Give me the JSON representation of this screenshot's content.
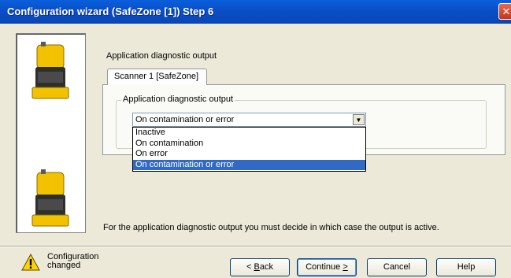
{
  "window": {
    "title": "Configuration wizard (SafeZone [1]) Step 6",
    "close_glyph": "✕"
  },
  "content": {
    "section_title": "Application diagnostic output",
    "tab_label": "Scanner 1 [SafeZone]",
    "group_label": "Application diagnostic output",
    "select_value": "On contamination or error",
    "dropdown_options": [
      "Inactive",
      "On contamination",
      "On error",
      "On contamination or error"
    ],
    "selected_option": "On contamination or error",
    "hint": "For the application diagnostic output you must decide in which case the output is active."
  },
  "status": {
    "line1": "Configuration",
    "line2": "changed"
  },
  "buttons": {
    "back_access": "B",
    "back_rest": "ack",
    "continue_rest": "Continue ",
    "continue_access": ">",
    "cancel": "Cancel",
    "help": "Help"
  },
  "colors": {
    "title_bar": "#0a4fc6",
    "selection": "#316ac5",
    "device_yellow": "#f2c200"
  }
}
